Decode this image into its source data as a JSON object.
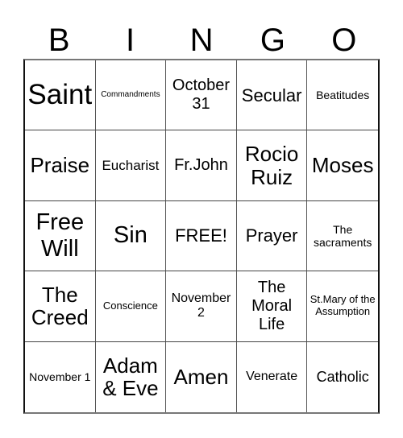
{
  "header": {
    "letters": [
      "B",
      "I",
      "N",
      "G",
      "O"
    ]
  },
  "board": {
    "rows": [
      [
        "Saint",
        "Commandments",
        "October 31",
        "Secular",
        "Beatitudes"
      ],
      [
        "Praise",
        "Eucharist",
        "Fr.John",
        "Rocio Ruiz",
        "Moses"
      ],
      [
        "Free Will",
        "Sin",
        "FREE!",
        "Prayer",
        "The sacraments"
      ],
      [
        "The Creed",
        "Conscience",
        "November 2",
        "The Moral Life",
        "St.Mary of the Assumption"
      ],
      [
        "November 1",
        "Adam & Eve",
        "Amen",
        "Venerate",
        "Catholic"
      ]
    ]
  }
}
